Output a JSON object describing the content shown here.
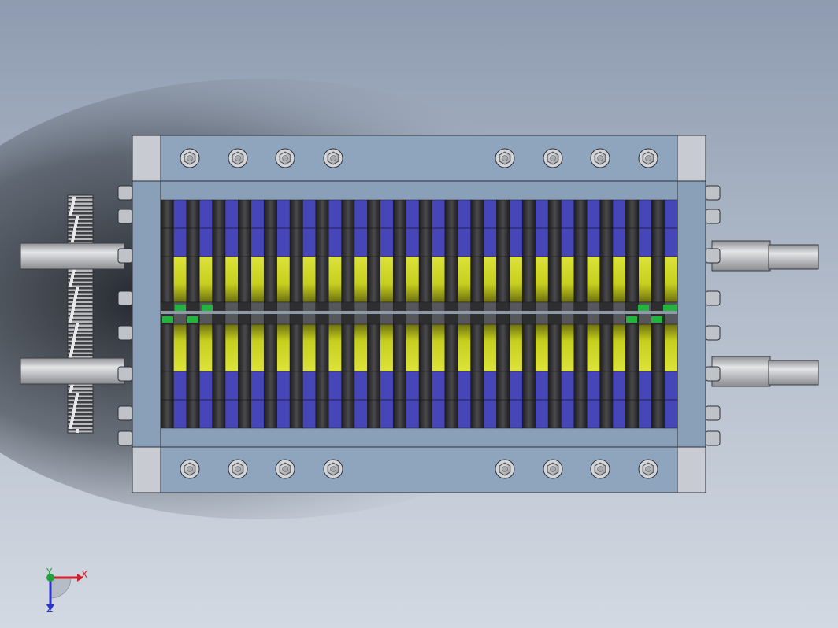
{
  "viewport": {
    "background_top": "#8e9bb0",
    "background_bottom": "#d3d9e2",
    "shadow_color": "#1c1f24"
  },
  "model": {
    "frame_color": "#8aa0b8",
    "frame_edge": "#2b2f36",
    "corner_block_color": "#c8ccd2",
    "blade_dark": "#3a3a3c",
    "blade_blue": "#4646b8",
    "blade_yellow": "#c6cf1e",
    "accent_green": "#22b43c",
    "shaft_color": "#c4c6c9",
    "gear_color": "#bfc1c4",
    "bolt_color": "#c9cbcf",
    "blade_columns": 20,
    "top_bolts_per_group": 4,
    "bottom_bolts_per_group": 4
  },
  "triad": {
    "x_label": "X",
    "y_label": "Y",
    "z_label": "Z",
    "x_color": "#d0202a",
    "y_color": "#1fa43a",
    "z_color": "#2a34c8"
  }
}
